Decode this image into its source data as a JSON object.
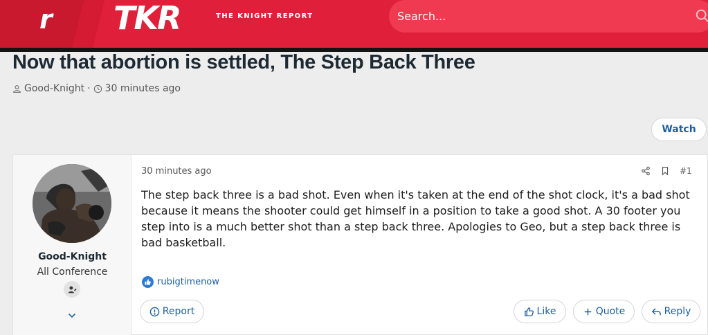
{
  "header": {
    "logo_r": "r",
    "logo_tkr": "TKR",
    "tagline": "THE KNIGHT REPORT",
    "search_placeholder": "Search..."
  },
  "thread": {
    "title": "Now that abortion is settled, The Step Back Three",
    "author": "Good-Knight",
    "separator": "·",
    "time": "30 minutes ago",
    "watch_label": "Watch"
  },
  "post": {
    "username": "Good-Knight",
    "user_title": "All Conference",
    "time": "30 minutes ago",
    "number": "#1",
    "body": "The step back three is a bad shot. Even when it's taken at the end of the shot clock, it's a bad shot because it means the shooter could get himself in a position to take a good shot. A 30 footer you step into is a much better shot than a step back three. Apologies to Geo, but a step back three is bad basketball.",
    "reaction_user": "rubigtimenow",
    "report_label": "Report",
    "like_label": "Like",
    "quote_label": "Quote",
    "reply_label": "Reply"
  },
  "colors": {
    "brand_red": "#e0203a",
    "link_blue": "#1d5fa0"
  }
}
